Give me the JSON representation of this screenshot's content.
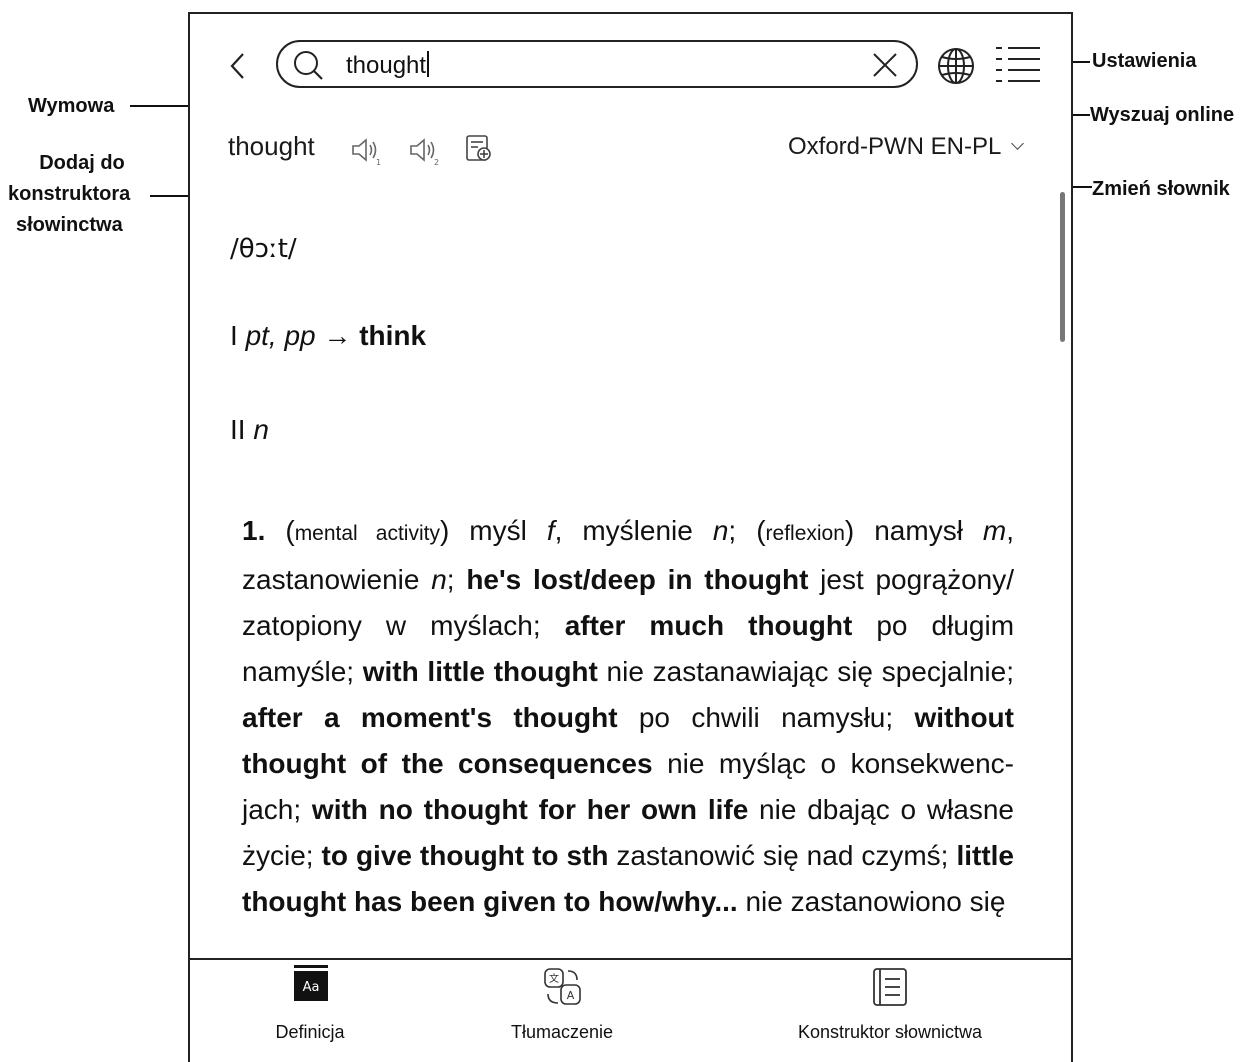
{
  "search": {
    "value": "thought"
  },
  "entry": {
    "headword": "thought",
    "dictionary": "Oxford-PWN EN-PL",
    "phonetic": "/θɔːt/",
    "line1": {
      "roman": "I",
      "pos": "pt, pp",
      "arrow": "→",
      "target": "think"
    },
    "line2": {
      "roman": "II",
      "pos": "n"
    }
  },
  "bottom_nav": {
    "definition": "Definicja",
    "translation": "Tłumaczenie",
    "vocab_builder": "Konstruktor słownictwa"
  },
  "annotations": {
    "settings": "Ustawienia",
    "search_online": "Wyszuaj online",
    "change_dictionary": "Zmień słownik",
    "pronunciation": "Wymowa",
    "add_to_vocab_1": "Dodaj do",
    "add_to_vocab_2": "konstruktora",
    "add_to_vocab_3": "słowinctwa"
  },
  "icons": {
    "back": "chevron-left-icon",
    "search": "search-icon",
    "clear": "close-icon",
    "globe": "globe-icon",
    "menu": "list-menu-icon",
    "speaker1": "speaker-icon",
    "speaker2": "speaker-icon",
    "add_vocab": "add-vocabulary-icon",
    "definition": "dictionary-aa-icon",
    "translation": "translate-icon",
    "vocab_builder": "notebook-list-icon"
  }
}
